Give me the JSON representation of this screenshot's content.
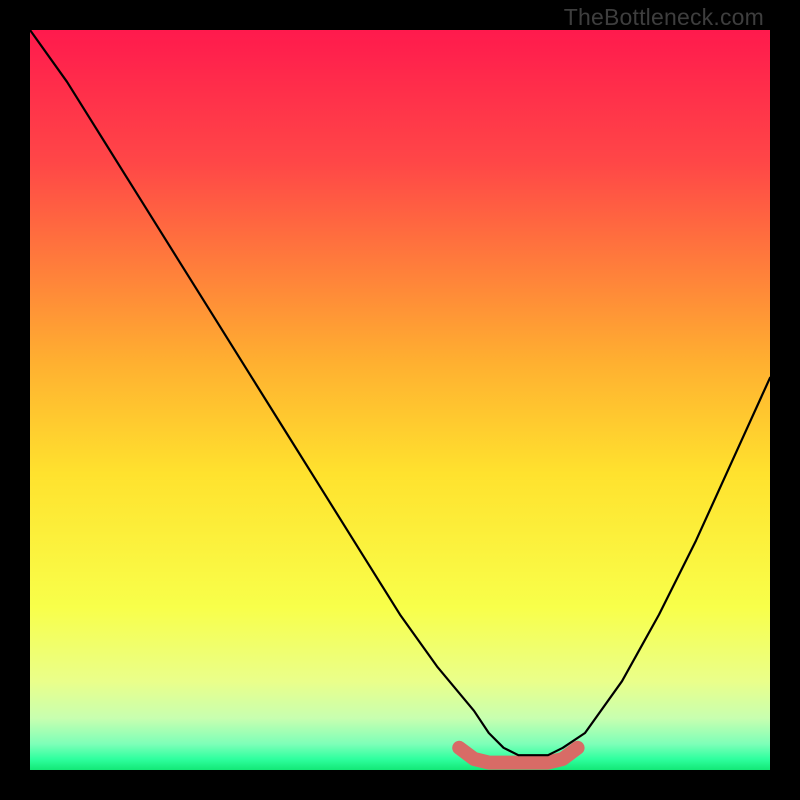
{
  "watermark": "TheBottleneck.com",
  "chart_data": {
    "type": "line",
    "title": "",
    "xlabel": "",
    "ylabel": "",
    "xlim": [
      0,
      100
    ],
    "ylim": [
      0,
      100
    ],
    "series": [
      {
        "name": "bottleneck-curve",
        "x": [
          0,
          5,
          10,
          15,
          20,
          25,
          30,
          35,
          40,
          45,
          50,
          55,
          60,
          62,
          64,
          66,
          68,
          70,
          72,
          75,
          80,
          85,
          90,
          95,
          100
        ],
        "values": [
          100,
          93,
          85,
          77,
          69,
          61,
          53,
          45,
          37,
          29,
          21,
          14,
          8,
          5,
          3,
          2,
          2,
          2,
          3,
          5,
          12,
          21,
          31,
          42,
          53
        ]
      },
      {
        "name": "optimal-range-marker",
        "x": [
          58,
          60,
          62,
          64,
          66,
          68,
          70,
          72,
          74
        ],
        "values": [
          3,
          1.5,
          1,
          1,
          1,
          1,
          1,
          1.5,
          3
        ]
      }
    ],
    "gradient_stops": [
      {
        "offset": 0,
        "color": "#ff1a4d"
      },
      {
        "offset": 0.18,
        "color": "#ff4747"
      },
      {
        "offset": 0.45,
        "color": "#ffb030"
      },
      {
        "offset": 0.6,
        "color": "#ffe22e"
      },
      {
        "offset": 0.78,
        "color": "#f8ff4a"
      },
      {
        "offset": 0.88,
        "color": "#eaff8a"
      },
      {
        "offset": 0.93,
        "color": "#c8ffb0"
      },
      {
        "offset": 0.965,
        "color": "#7dffb8"
      },
      {
        "offset": 0.985,
        "color": "#2fff9f"
      },
      {
        "offset": 1.0,
        "color": "#13e876"
      }
    ],
    "marker_color": "#d86b66",
    "curve_color": "#000000"
  }
}
